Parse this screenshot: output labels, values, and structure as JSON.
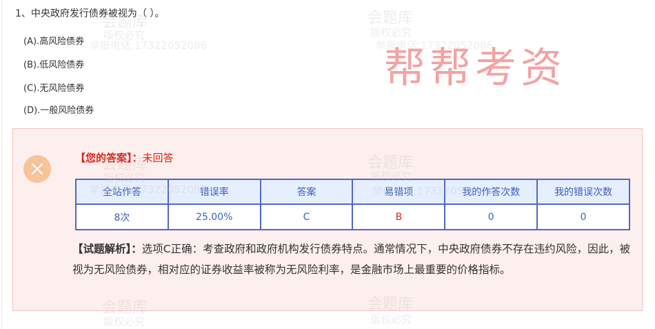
{
  "question": {
    "stem": "1、中央政府发行债券被视为（ ）。",
    "options": [
      "(A).高风险债券",
      "(B).低风险债券",
      "(C).无风险债券",
      "(D).一般风险债券"
    ]
  },
  "watermarks": {
    "site": "会题库",
    "rights": "版权必究",
    "report": "举报电话:17322052086"
  },
  "stamp": "帮帮考资",
  "result": {
    "your_answer_label": "【您的答案】：",
    "your_answer_value": "未回答",
    "icon": "wrong-x-icon",
    "table": {
      "headers": [
        "全站作答",
        "错误率",
        "答案",
        "易错项",
        "我的作答次数",
        "我的错误次数"
      ],
      "values": [
        "8次",
        "25.00%",
        "C",
        "B",
        "0",
        "0"
      ]
    },
    "analysis_label": "【试题解析】：",
    "analysis_text": "选项C正确：考查政府和政府机构发行债券特点。通常情况下，中央政府债券不存在违约风险，因此，被视为无风险债券，相对应的证券收益率被称为无风险利率，是金融市场上最重要的价格指标。"
  },
  "colors": {
    "accent_red": "#d9261c",
    "table_blue": "#5266c6",
    "box_bg": "#fdefed",
    "icon_bg": "#f7c39a"
  }
}
